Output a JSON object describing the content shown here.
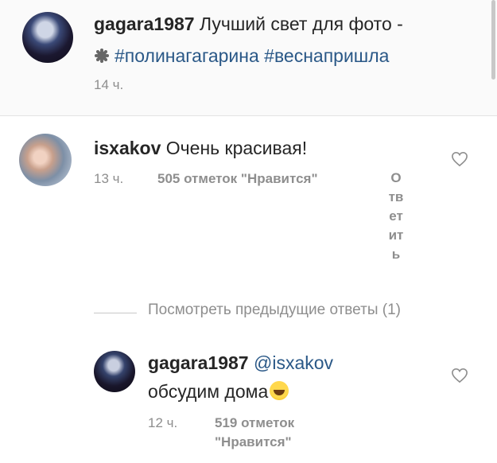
{
  "caption": {
    "username": "gagara1987",
    "text_line1": "Лучший свет для фото -",
    "hashtags": "#полинагагарина #веснапришла",
    "time": "14 ч."
  },
  "comment1": {
    "username": "isxakov",
    "text": "Очень красивая!",
    "time": "13 ч.",
    "likes": "505 отметок \"Нравится\"",
    "reply_chars": [
      "О",
      "тв",
      "ет",
      "ит",
      "ь"
    ]
  },
  "view_previous": "Посмотреть предыдущие ответы (1)",
  "reply1": {
    "username": "gagara1987",
    "mention": "@isxakov",
    "text": "обсудим дома",
    "time": "12 ч.",
    "likes_line1": "519 отметок",
    "likes_line2": "\"Нравится\""
  },
  "icons": {
    "sun": "sun-icon",
    "heart": "heart-outline-icon",
    "emoji": "laughing-emoji-icon"
  }
}
